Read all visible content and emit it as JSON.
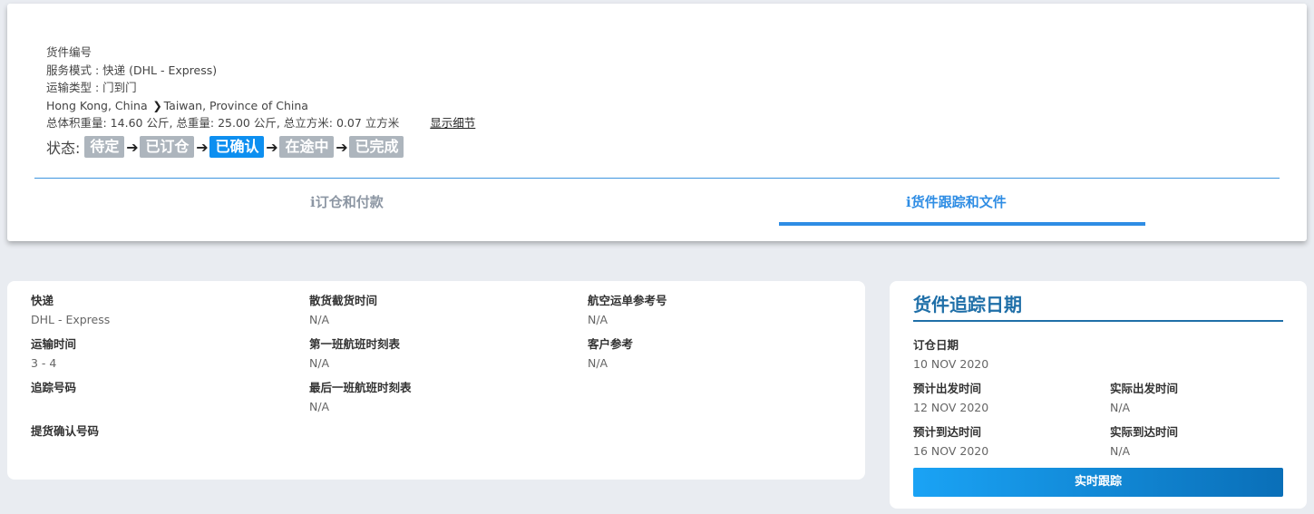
{
  "shipment": {
    "number_label": "货件编号",
    "service_mode": "服务模式 : 快递 (DHL - Express)",
    "transport_type": "运输类型 : 门到门",
    "origin": "Hong Kong, China",
    "destination": "Taiwan, Province of China",
    "weights": "总体积重量: 14.60 公斤, 总重量: 25.00 公斤, 总立方米: 0.07 立方米",
    "details_link": "显示细节"
  },
  "status": {
    "label": "状态:",
    "steps": [
      "待定",
      "已订仓",
      "已确认",
      "在途中",
      "已完成"
    ],
    "active_index": 2,
    "active_color": "#0d8ff0",
    "inactive_color": "#adb5bd"
  },
  "tabs": {
    "booking": "订仓和付款",
    "tracking": "货件跟踪和文件",
    "active": "tracking"
  },
  "details": {
    "express": {
      "label": "快递",
      "value": "DHL - Express"
    },
    "transit_time": {
      "label": "运输时间",
      "value": "3 - 4"
    },
    "tracking_no": {
      "label": "追踪号码"
    },
    "pickup_no": {
      "label": "提货确认号码"
    },
    "cargo_cutoff": {
      "label": "散货截货时间",
      "value": "N/A"
    },
    "first_flight": {
      "label": "第一班航班时刻表",
      "value": "N/A"
    },
    "last_flight": {
      "label": "最后一班航班时刻表",
      "value": "N/A"
    },
    "awb_ref": {
      "label": "航空运单参考号",
      "value": "N/A"
    },
    "customer_ref": {
      "label": "客户参考",
      "value": "N/A"
    }
  },
  "tracking_dates": {
    "title": "货件追踪日期",
    "booking_date": {
      "label": "订仓日期",
      "value": "10 NOV 2020"
    },
    "est_departure": {
      "label": "预计出发时间",
      "value": "12 NOV 2020"
    },
    "actual_departure": {
      "label": "实际出发时间",
      "value": "N/A"
    },
    "est_arrival": {
      "label": "预计到达时间",
      "value": "16 NOV 2020"
    },
    "actual_arrival": {
      "label": "实际到达时间",
      "value": "N/A"
    },
    "button": "实时跟踪"
  }
}
